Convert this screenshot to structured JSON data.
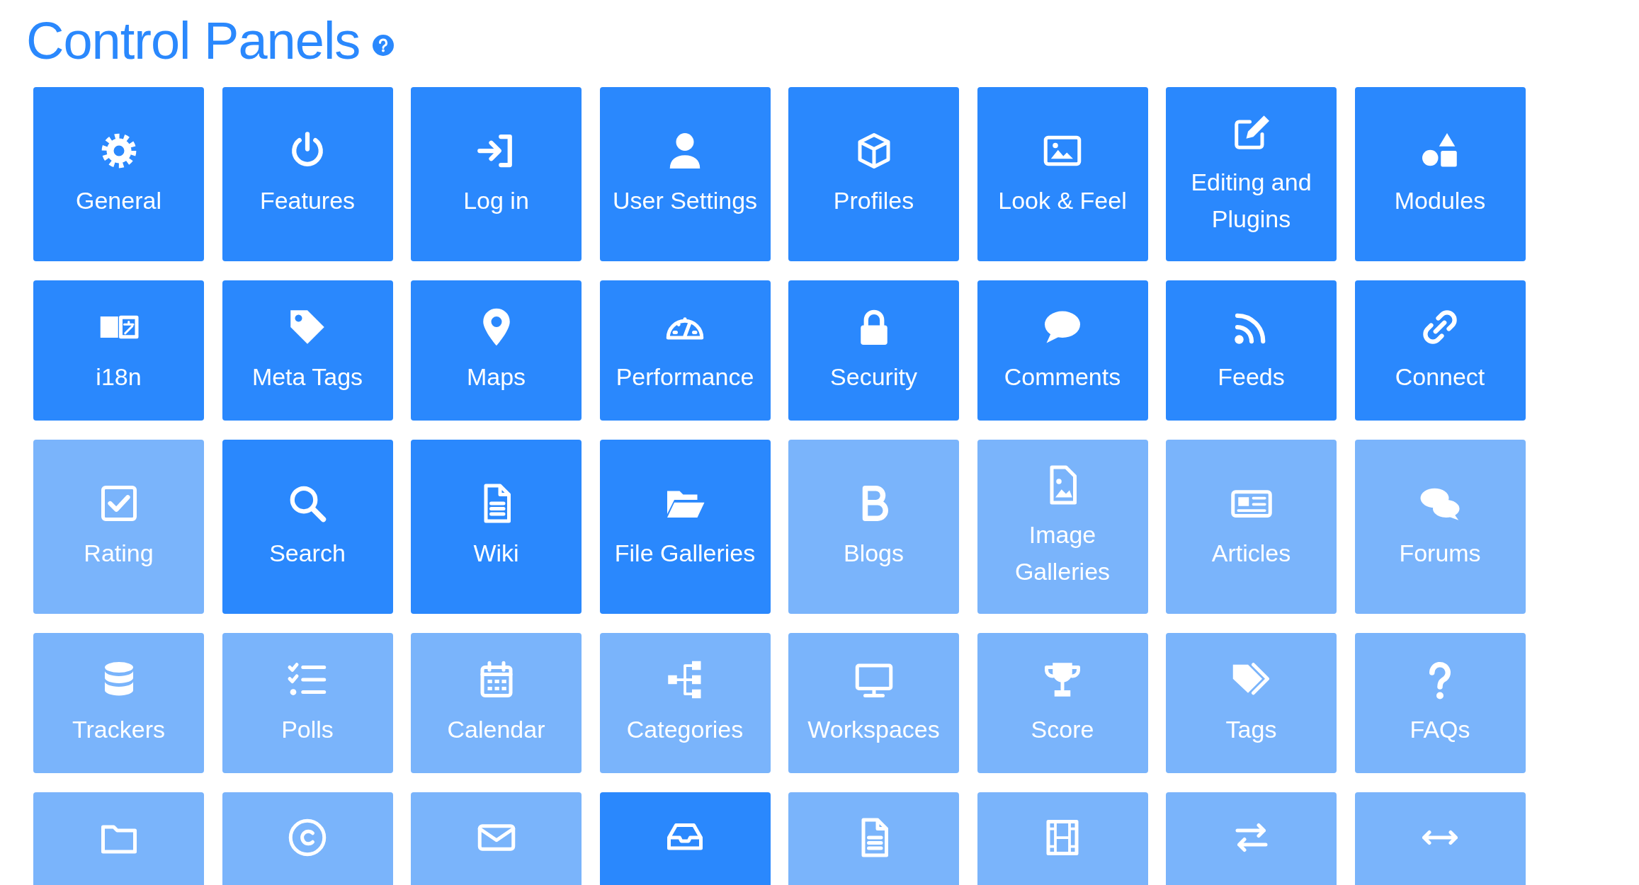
{
  "title": "Control Panels",
  "tiles": [
    {
      "label": "General",
      "enabled": true
    },
    {
      "label": "Features",
      "enabled": true
    },
    {
      "label": "Log in",
      "enabled": true
    },
    {
      "label": "User Settings",
      "enabled": true
    },
    {
      "label": "Profiles",
      "enabled": true
    },
    {
      "label": "Look & Feel",
      "enabled": true
    },
    {
      "label": "Editing and Plugins",
      "enabled": true
    },
    {
      "label": "Modules",
      "enabled": true
    },
    {
      "label": "i18n",
      "enabled": true
    },
    {
      "label": "Meta Tags",
      "enabled": true
    },
    {
      "label": "Maps",
      "enabled": true
    },
    {
      "label": "Performance",
      "enabled": true
    },
    {
      "label": "Security",
      "enabled": true
    },
    {
      "label": "Comments",
      "enabled": true
    },
    {
      "label": "Feeds",
      "enabled": true
    },
    {
      "label": "Connect",
      "enabled": true
    },
    {
      "label": "Rating",
      "enabled": false
    },
    {
      "label": "Search",
      "enabled": true
    },
    {
      "label": "Wiki",
      "enabled": true
    },
    {
      "label": "File Galleries",
      "enabled": true
    },
    {
      "label": "Blogs",
      "enabled": false
    },
    {
      "label": "Image Galleries",
      "enabled": false
    },
    {
      "label": "Articles",
      "enabled": false
    },
    {
      "label": "Forums",
      "enabled": false
    },
    {
      "label": "Trackers",
      "enabled": false
    },
    {
      "label": "Polls",
      "enabled": false
    },
    {
      "label": "Calendar",
      "enabled": false
    },
    {
      "label": "Categories",
      "enabled": false
    },
    {
      "label": "Workspaces",
      "enabled": false
    },
    {
      "label": "Score",
      "enabled": false
    },
    {
      "label": "Tags",
      "enabled": false
    },
    {
      "label": "FAQs",
      "enabled": false
    },
    {
      "enabled": false
    },
    {
      "enabled": false
    },
    {
      "enabled": false
    },
    {
      "enabled": true
    },
    {
      "enabled": false
    },
    {
      "enabled": false
    },
    {
      "enabled": false
    },
    {
      "enabled": false
    }
  ]
}
